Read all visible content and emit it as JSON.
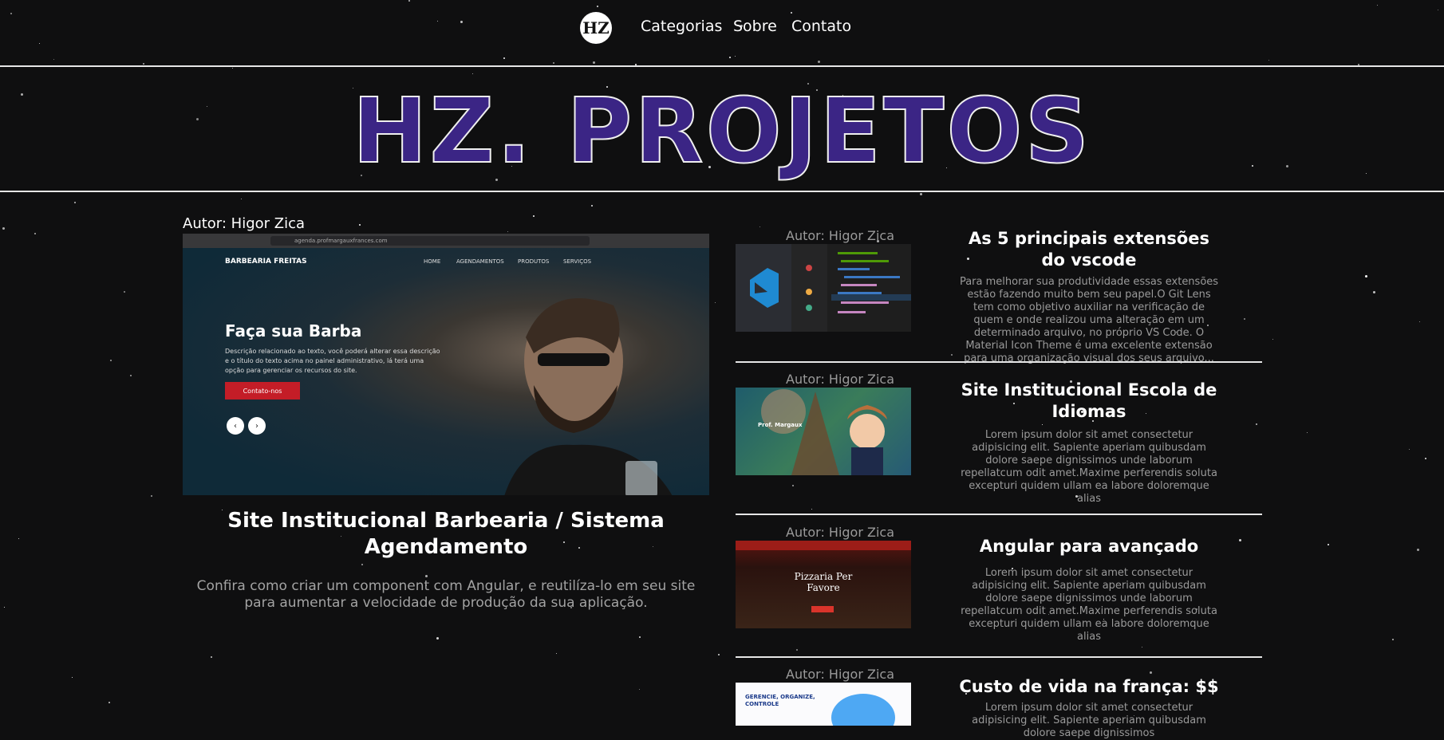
{
  "nav": {
    "logo": "HZ",
    "links": [
      "Categorias",
      "Sobre",
      "Contato"
    ]
  },
  "hero": {
    "title": "HZ. PROJETOS"
  },
  "featured": {
    "author": "Autor: Higor Zica",
    "title": "Site Institucional Barbearia / Sistema Agendamento",
    "description": "Confira como criar um component com Angular, e reutilíza-lo em seu site para aumentar a velocidade de produção da sua aplicação.",
    "preview": {
      "url": "agenda.profmargauxfrances.com",
      "brand": "BARBEARIA FREITAS",
      "menu": [
        "HOME",
        "AGENDAMENTOS",
        "PRODUTOS",
        "SERVIÇOS"
      ],
      "heading": "Faça sua Barba",
      "text": "Descrição relacionado ao texto, você poderá alterar essa descrição e o título do texto acima no painel administrativo, lá terá uma opção para gerenciar os recursos do site.",
      "button": "Contato-nos"
    }
  },
  "posts": [
    {
      "author": "Autor: Higor Zica",
      "title": "As 5 principais extensões do vscode",
      "description": "Para melhorar sua produtividade essas extensões estão fazendo muito bem seu papel.O Git Lens tem como objetivo auxiliar na verificação de quem e onde realizou uma alteração em um determinado arquivo, no próprio VS Code. O Material Icon Theme é uma excelente extensão para uma organização visual dos seus arquivo..."
    },
    {
      "author": "Autor: Higor Zica",
      "title": "Site Institucional Escola de Idiomas",
      "description": "Lorem ipsum dolor sit amet consectetur adipisicing elit. Sapiente aperiam quibusdam dolore saepe dignissimos unde laborum repellatcum odit amet.Maxime perferendis soluta excepturi quidem ullam ea labore doloremque alias",
      "thumb_caption": "Prof. Margaux"
    },
    {
      "author": "Autor: Higor Zica",
      "title": "Angular para avançado",
      "description": "Lorem ipsum dolor sit amet consectetur adipisicing elit. Sapiente aperiam quibusdam dolore saepe dignissimos unde laborum repellatcum odit amet.Maxime perferendis soluta excepturi quidem ullam ea labore doloremque alias",
      "thumb_caption": "Pizzaria Per Favore"
    },
    {
      "author": "Autor: Higor Zica",
      "title": "Custo de vida na frança: $$",
      "description": "Lorem ipsum dolor sit amet consectetur adipisicing elit. Sapiente aperiam quibusdam dolore saepe dignissimos",
      "thumb_caption": "GERENCIE, ORGANIZE, CONTROLE"
    }
  ],
  "colors": {
    "background": "#0f0f10",
    "accent": "#3b2585",
    "muted_text": "#9a9a9a"
  }
}
